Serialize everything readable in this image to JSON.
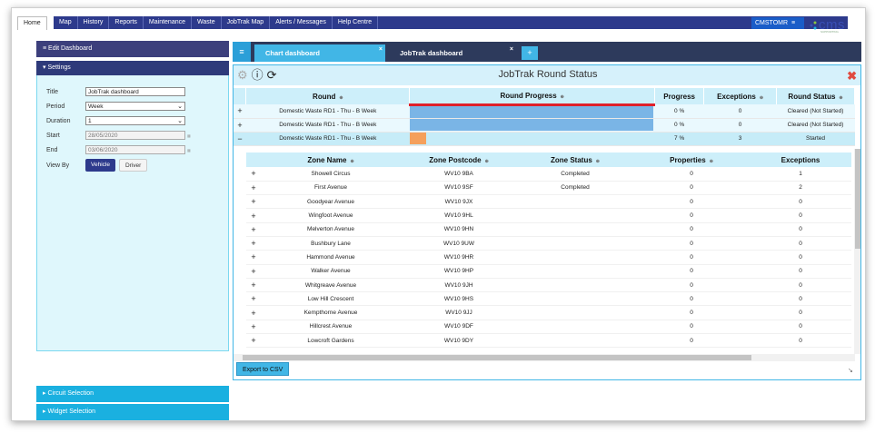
{
  "nav": {
    "home": "Home",
    "items": [
      "Map",
      "History",
      "Reports",
      "Maintenance",
      "Waste",
      "JobTrak Map",
      "Alerts / Messages",
      "Help Centre"
    ],
    "user": "CMSTOMR",
    "logo": "cms",
    "logo_sub": "SUPPORTING"
  },
  "left": {
    "edit_dashboard": "Edit Dashboard",
    "settings": "Settings",
    "fields": {
      "title_label": "Title",
      "title_value": "JobTrak dashboard",
      "period_label": "Period",
      "period_value": "Week",
      "duration_label": "Duration",
      "duration_value": "1",
      "start_label": "Start",
      "start_value": "28/05/2020",
      "end_label": "End",
      "end_value": "03/06/2020",
      "viewby_label": "View By",
      "vehicle": "Vehicle",
      "driver": "Driver"
    },
    "circuit_selection": "Circuit Selection",
    "widget_selection": "Widget Selection"
  },
  "tabs": {
    "menu": "≡",
    "chart_dashboard": "Chart dashboard",
    "jobtrak_dashboard": "JobTrak dashboard",
    "add": "+"
  },
  "widget": {
    "title": "JobTrak Round Status",
    "outer_headers": [
      "Round",
      "Round Progress",
      "Progress",
      "Exceptions",
      "Round Status"
    ],
    "rounds": [
      {
        "toggle": "+",
        "name": "Domestic Waste RD1 - Thu - B Week",
        "progress": "0 %",
        "exceptions": "0",
        "status": "Cleared (Not Started)",
        "fill": 1.0,
        "color": "#7ab5e6"
      },
      {
        "toggle": "+",
        "name": "Domestic Waste RD1 - Thu - B Week",
        "progress": "0 %",
        "exceptions": "0",
        "status": "Cleared (Not Started)",
        "fill": 1.0,
        "color": "#7ab5e6"
      },
      {
        "toggle": "−",
        "name": "Domestic Waste RD1 - Thu - B Week",
        "progress": "7 %",
        "exceptions": "3",
        "status": "Started",
        "fill": 0.07,
        "color": "#f5a05c"
      }
    ],
    "inner_headers": [
      "Zone Name",
      "Zone Postcode",
      "Zone Status",
      "Properties",
      "Exceptions"
    ],
    "zones": [
      {
        "name": "Showell Circus",
        "postcode": "WV10 9BA",
        "status": "Completed",
        "properties": "0",
        "exceptions": "1"
      },
      {
        "name": "First Avenue",
        "postcode": "WV10 9SF",
        "status": "Completed",
        "properties": "0",
        "exceptions": "2"
      },
      {
        "name": "Goodyear Avenue",
        "postcode": "WV10 9JX",
        "status": "",
        "properties": "0",
        "exceptions": "0"
      },
      {
        "name": "Wingfoot Avenue",
        "postcode": "WV10 9HL",
        "status": "",
        "properties": "0",
        "exceptions": "0"
      },
      {
        "name": "Melverton Avenue",
        "postcode": "WV10 9HN",
        "status": "",
        "properties": "0",
        "exceptions": "0"
      },
      {
        "name": "Bushbury Lane",
        "postcode": "WV10 9UW",
        "status": "",
        "properties": "0",
        "exceptions": "0"
      },
      {
        "name": "Hammond Avenue",
        "postcode": "WV10 9HR",
        "status": "",
        "properties": "0",
        "exceptions": "0"
      },
      {
        "name": "Walker Avenue",
        "postcode": "WV10 9HP",
        "status": "",
        "properties": "0",
        "exceptions": "0"
      },
      {
        "name": "Whitgreave Avenue",
        "postcode": "WV10 9JH",
        "status": "",
        "properties": "0",
        "exceptions": "0"
      },
      {
        "name": "Low Hill Crescent",
        "postcode": "WV10 9HS",
        "status": "",
        "properties": "0",
        "exceptions": "0"
      },
      {
        "name": "Kempthorne Avenue",
        "postcode": "WV10 9JJ",
        "status": "",
        "properties": "0",
        "exceptions": "0"
      },
      {
        "name": "Hillcrest Avenue",
        "postcode": "WV10 9DF",
        "status": "",
        "properties": "0",
        "exceptions": "0"
      },
      {
        "name": "Lowcroft Gardens",
        "postcode": "WV10 9DY",
        "status": "",
        "properties": "0",
        "exceptions": "0"
      }
    ],
    "export": "Export to CSV"
  }
}
